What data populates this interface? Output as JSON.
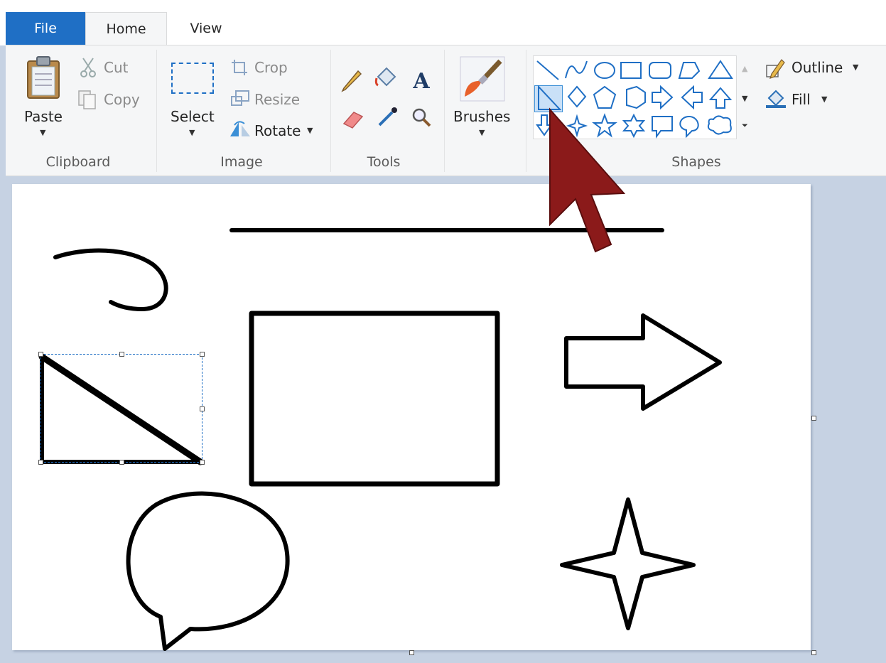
{
  "tabs": {
    "file": "File",
    "home": "Home",
    "view": "View"
  },
  "clipboard": {
    "group_label": "Clipboard",
    "paste": "Paste",
    "cut": "Cut",
    "copy": "Copy"
  },
  "image": {
    "group_label": "Image",
    "select": "Select",
    "crop": "Crop",
    "resize": "Resize",
    "rotate": "Rotate"
  },
  "tools": {
    "group_label": "Tools",
    "icons": [
      "pencil-icon",
      "fill-bucket-icon",
      "text-icon",
      "eraser-icon",
      "color-picker-icon",
      "magnifier-icon"
    ]
  },
  "brushes": {
    "label": "Brushes"
  },
  "shapes": {
    "group_label": "Shapes",
    "outline": "Outline",
    "fill": "Fill",
    "gallery": [
      "line",
      "curve",
      "oval",
      "rectangle",
      "rounded-rectangle",
      "polygon",
      "triangle",
      "right-triangle",
      "diamond",
      "pentagon",
      "hexagon",
      "right-arrow",
      "left-arrow",
      "up-arrow",
      "down-arrow",
      "four-point-star",
      "five-point-star",
      "six-point-star",
      "rounded-callout",
      "oval-callout",
      "cloud-callout"
    ],
    "selected": "right-triangle"
  },
  "colors": {
    "accent": "#1f6fc5",
    "selected_shape_bg": "#c9e0f7",
    "cursor": "#8b1a1a"
  }
}
